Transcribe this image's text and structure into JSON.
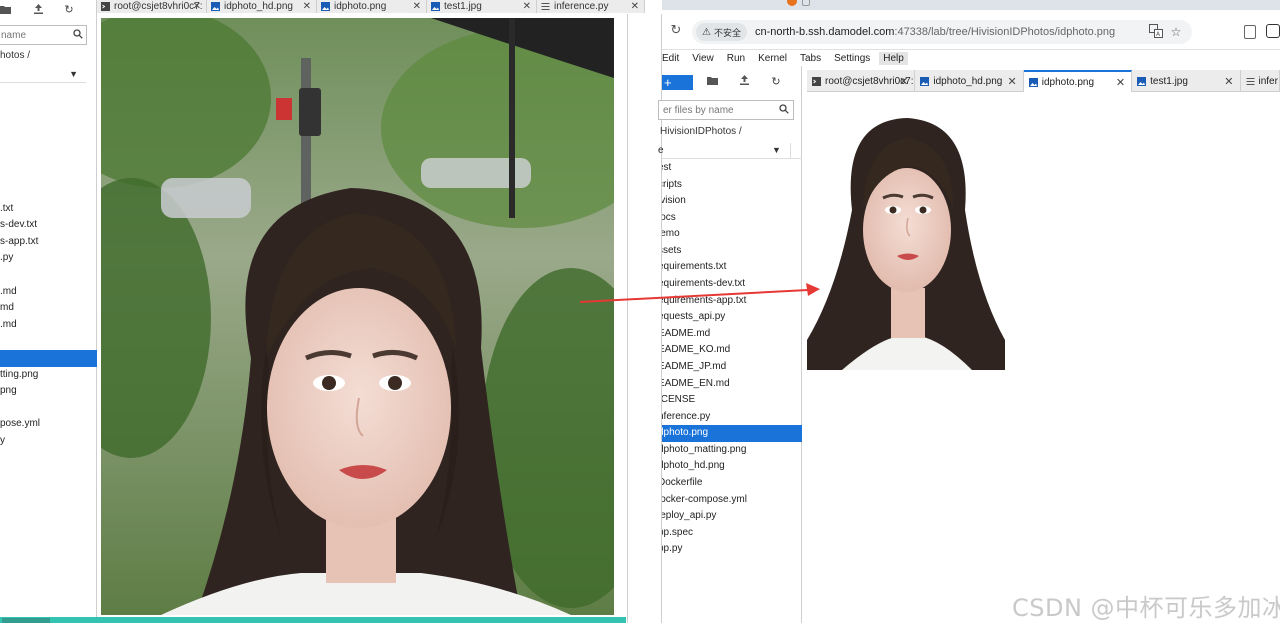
{
  "left_window": {
    "search_placeholder": "name",
    "breadcrumb": "hotos /",
    "files": [
      {
        "name": "",
        "selected": false
      },
      {
        "name": ".txt",
        "selected": false
      },
      {
        "name": "s-dev.txt",
        "selected": false
      },
      {
        "name": "s-app.txt",
        "selected": false
      },
      {
        "name": ".py",
        "selected": false
      },
      {
        "name": "",
        "selected": false
      },
      {
        "name": ".md",
        "selected": false
      },
      {
        "name": "md",
        "selected": false
      },
      {
        "name": ".md",
        "selected": false
      },
      {
        "name": "",
        "selected": false
      },
      {
        "name": "",
        "selected": true
      },
      {
        "name": "tting.png",
        "selected": false
      },
      {
        "name": "png",
        "selected": false
      },
      {
        "name": "",
        "selected": false
      },
      {
        "name": "pose.yml",
        "selected": false
      },
      {
        "name": "y",
        "selected": false
      }
    ]
  },
  "center_window": {
    "tabs": [
      {
        "label": "root@csjet8vhri0c7:",
        "icon": "terminal-icon",
        "width": 110
      },
      {
        "label": "idphoto_hd.png",
        "icon": "image-file-icon",
        "width": 110
      },
      {
        "label": "idphoto.png",
        "icon": "image-file-icon",
        "width": 110
      },
      {
        "label": "test1.jpg",
        "icon": "image-file-icon",
        "width": 110
      },
      {
        "label": "inference.py",
        "icon": "python-file-icon",
        "width": 108
      }
    ]
  },
  "browser": {
    "insecure_label": "不安全",
    "url_host": "cn-north-b.ssh.damodel.com",
    "url_path": ":47338/lab/tree/HivisionIDPhotos/idphoto.png"
  },
  "jupyter": {
    "menu": [
      "Edit",
      "View",
      "Run",
      "Kernel",
      "Tabs",
      "Settings",
      "Help"
    ],
    "active_menu": "Help",
    "new_label": "+",
    "filter_placeholder": "er files by name",
    "breadcrumb": "HivisionIDPhotos /",
    "column_name": "e",
    "files": [
      {
        "name": "est",
        "selected": false
      },
      {
        "name": "cripts",
        "selected": false
      },
      {
        "name": "ivision",
        "selected": false
      },
      {
        "name": "locs",
        "selected": false
      },
      {
        "name": "lemo",
        "selected": false
      },
      {
        "name": "ssets",
        "selected": false
      },
      {
        "name": "equirements.txt",
        "selected": false
      },
      {
        "name": "equirements-dev.txt",
        "selected": false
      },
      {
        "name": "equirements-app.txt",
        "selected": false
      },
      {
        "name": "equests_api.py",
        "selected": false
      },
      {
        "name": "EADME.md",
        "selected": false
      },
      {
        "name": "EADME_KO.md",
        "selected": false
      },
      {
        "name": "EADME_JP.md",
        "selected": false
      },
      {
        "name": "EADME_EN.md",
        "selected": false
      },
      {
        "name": "ICENSE",
        "selected": false
      },
      {
        "name": "nference.py",
        "selected": false
      },
      {
        "name": "dphoto.png",
        "selected": true
      },
      {
        "name": "dphoto_matting.png",
        "selected": false
      },
      {
        "name": "dphoto_hd.png",
        "selected": false
      },
      {
        "name": "Dockerfile",
        "selected": false
      },
      {
        "name": "locker-compose.yml",
        "selected": false
      },
      {
        "name": "leploy_api.py",
        "selected": false
      },
      {
        "name": "pp.spec",
        "selected": false
      },
      {
        "name": "pp.py",
        "selected": false
      }
    ],
    "tabs": [
      {
        "label": "root@csjet8vhri0c7:",
        "icon": "terminal-icon",
        "active": false,
        "width": 110
      },
      {
        "label": "idphoto_hd.png",
        "icon": "image-file-icon",
        "active": false,
        "width": 110
      },
      {
        "label": "idphoto.png",
        "icon": "image-file-icon",
        "active": true,
        "width": 110
      },
      {
        "label": "test1.jpg",
        "icon": "image-file-icon",
        "active": false,
        "width": 110
      },
      {
        "label": "infer",
        "icon": "python-file-icon",
        "active": false,
        "width": 40
      }
    ]
  },
  "watermark": "CSDN @中杯可乐多加冰",
  "colors": {
    "selection": "#1a73d9",
    "arrow": "#e53935",
    "teal_bar": "#34c3b0"
  }
}
